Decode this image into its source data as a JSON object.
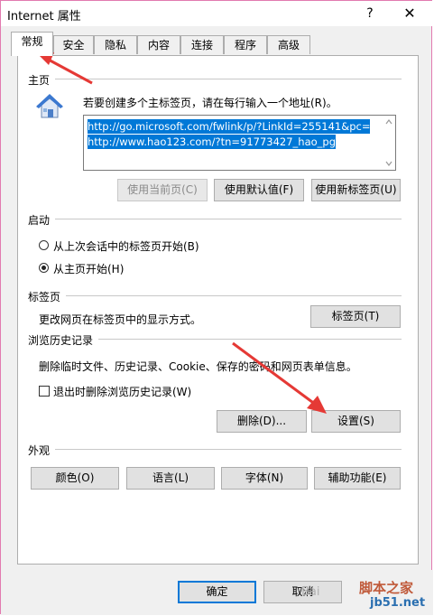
{
  "window": {
    "title": "Internet 属性",
    "help_glyph": "?",
    "close_glyph": "✕"
  },
  "tabs": [
    "常规",
    "安全",
    "隐私",
    "内容",
    "连接",
    "程序",
    "高级"
  ],
  "home": {
    "section_title": "主页",
    "instruction": "若要创建多个主标签页，请在每行输入一个地址(R)。",
    "urls": [
      "http://go.microsoft.com/fwlink/p/?LinkId=255141&pc=",
      "http://www.hao123.com/?tn=91773427_hao_pg"
    ],
    "buttons": {
      "use_current": "使用当前页(C)",
      "use_default": "使用默认值(F)",
      "use_new_tab": "使用新标签页(U)"
    }
  },
  "startup": {
    "section_title": "启动",
    "options": [
      "从上次会话中的标签页开始(B)",
      "从主页开始(H)"
    ],
    "selected_index": 1
  },
  "tabs_section": {
    "section_title": "标签页",
    "description": "更改网页在标签页中的显示方式。",
    "button": "标签页(T)"
  },
  "history": {
    "section_title": "浏览历史记录",
    "description": "删除临时文件、历史记录、Cookie、保存的密码和网页表单信息。",
    "checkbox_label": "退出时删除浏览历史记录(W)",
    "checkbox_checked": false,
    "delete_button": "删除(D)...",
    "settings_button": "设置(S)"
  },
  "appearance": {
    "section_title": "外观",
    "buttons": [
      "颜色(O)",
      "语言(L)",
      "字体(N)",
      "辅助功能(E)"
    ]
  },
  "footer": {
    "ok": "确定",
    "cancel": "取消"
  },
  "watermark": {
    "line1": "脚本之家",
    "line2": "jb51.net",
    "prefix": "Bai"
  }
}
